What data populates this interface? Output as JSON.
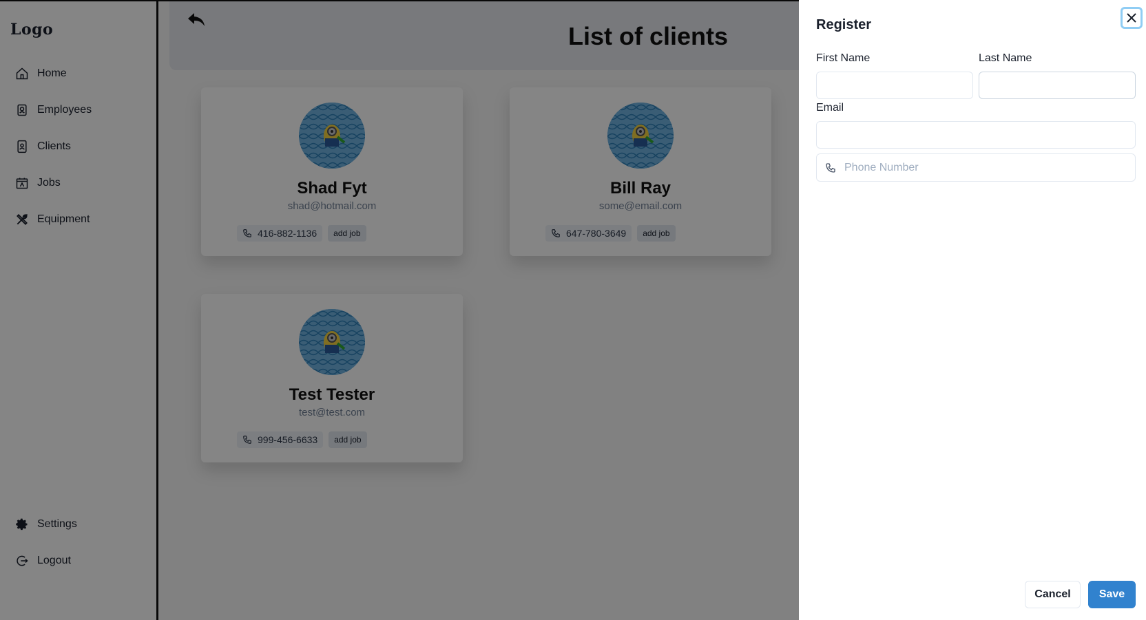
{
  "sidebar": {
    "logo": "Logo",
    "nav": [
      {
        "label": "Home",
        "icon": "home-icon"
      },
      {
        "label": "Employees",
        "icon": "employee-badge-icon"
      },
      {
        "label": "Clients",
        "icon": "client-contact-icon"
      },
      {
        "label": "Jobs",
        "icon": "calendar-icon"
      },
      {
        "label": "Equipment",
        "icon": "tools-icon"
      }
    ],
    "bottom": [
      {
        "label": "Settings",
        "icon": "gear-icon"
      },
      {
        "label": "Logout",
        "icon": "logout-icon"
      }
    ]
  },
  "header": {
    "title": "List of clients",
    "back_icon": "reply-arrow-icon"
  },
  "clients": [
    {
      "name": "Shad Fyt",
      "email": "shad@hotmail.com",
      "phone": "416-882-1136",
      "add_job": "add job"
    },
    {
      "name": "Bill Ray",
      "email": "some@email.com",
      "phone": "647-780-3649",
      "add_job": "add job"
    },
    {
      "name": "Test Tester",
      "email": "test@test.com",
      "phone": "999-456-6633",
      "add_job": "add job"
    }
  ],
  "drawer": {
    "title": "Register",
    "first_name_label": "First Name",
    "last_name_label": "Last Name",
    "email_label": "Email",
    "first_name_value": "",
    "last_name_value": "",
    "email_value": "",
    "phone_placeholder": "Phone Number",
    "cancel_label": "Cancel",
    "save_label": "Save"
  },
  "colors": {
    "accent": "#3182ce",
    "focus_ring": "#90cdf4",
    "overlay": "rgba(0,0,0,0.48)"
  }
}
